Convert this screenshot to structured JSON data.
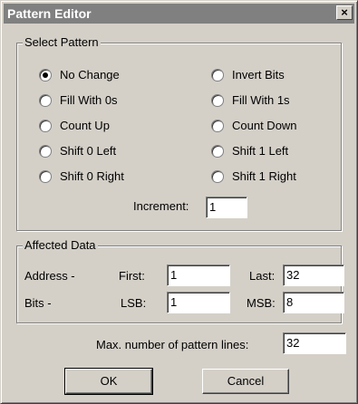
{
  "window": {
    "title": "Pattern Editor",
    "close_glyph": "×"
  },
  "select_pattern": {
    "group_label": "Select Pattern",
    "options_left": [
      "No Change",
      "Fill With 0s",
      "Count Up",
      "Shift 0 Left",
      "Shift 0 Right"
    ],
    "options_right": [
      "Invert Bits",
      "Fill With 1s",
      "Count Down",
      "Shift 1 Left",
      "Shift 1 Right"
    ],
    "selected": "No Change",
    "increment_label": "Increment:",
    "increment_value": "1"
  },
  "affected_data": {
    "group_label": "Affected Data",
    "address_label": "Address -",
    "first_label": "First:",
    "first_value": "1",
    "last_label": "Last:",
    "last_value": "32",
    "bits_label": "Bits -",
    "lsb_label": "LSB:",
    "lsb_value": "1",
    "msb_label": "MSB:",
    "msb_value": "8"
  },
  "max_lines": {
    "label": "Max. number of pattern lines:",
    "value": "32"
  },
  "buttons": {
    "ok": "OK",
    "cancel": "Cancel"
  }
}
